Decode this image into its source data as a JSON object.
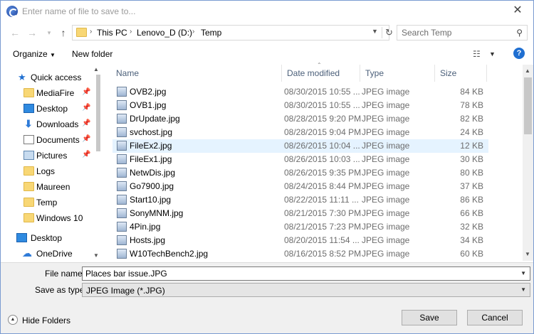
{
  "window": {
    "title": "Enter name of file to save to..."
  },
  "address": {
    "crumbs": [
      "This PC",
      "Lenovo_D (D:)",
      "Temp"
    ]
  },
  "search": {
    "placeholder": "Search Temp"
  },
  "toolbar": {
    "organize_label": "Organize",
    "new_folder_label": "New folder"
  },
  "nav": {
    "items": [
      {
        "label": "Quick access",
        "icon": "star-icon"
      },
      {
        "label": "MediaFire",
        "icon": "folder-icon",
        "pinned": true
      },
      {
        "label": "Desktop",
        "icon": "desktop-icon",
        "pinned": true
      },
      {
        "label": "Downloads",
        "icon": "download-icon",
        "pinned": true
      },
      {
        "label": "Documents",
        "icon": "document-icon",
        "pinned": true
      },
      {
        "label": "Pictures",
        "icon": "pictures-icon",
        "pinned": true
      },
      {
        "label": "Logs",
        "icon": "folder-icon"
      },
      {
        "label": "Maureen",
        "icon": "folder-icon"
      },
      {
        "label": "Temp",
        "icon": "folder-icon"
      },
      {
        "label": "Windows 10",
        "icon": "folder-icon"
      },
      {
        "label": "Desktop",
        "icon": "desktop-icon"
      },
      {
        "label": "OneDrive",
        "icon": "onedrive-icon"
      }
    ]
  },
  "columns": {
    "name": "Name",
    "date": "Date modified",
    "type": "Type",
    "size": "Size"
  },
  "files": [
    {
      "name": "OVB2.jpg",
      "date": "08/30/2015 10:55 ...",
      "type": "JPEG image",
      "size": "84 KB"
    },
    {
      "name": "OVB1.jpg",
      "date": "08/30/2015 10:55 ...",
      "type": "JPEG image",
      "size": "78 KB"
    },
    {
      "name": "DrUpdate.jpg",
      "date": "08/28/2015 9:20 PM",
      "type": "JPEG image",
      "size": "82 KB"
    },
    {
      "name": "svchost.jpg",
      "date": "08/28/2015 9:04 PM",
      "type": "JPEG image",
      "size": "24 KB"
    },
    {
      "name": "FileEx2.jpg",
      "date": "08/26/2015 10:04 ...",
      "type": "JPEG image",
      "size": "12 KB",
      "selected": true
    },
    {
      "name": "FileEx1.jpg",
      "date": "08/26/2015 10:03 ...",
      "type": "JPEG image",
      "size": "30 KB"
    },
    {
      "name": "NetwDis.jpg",
      "date": "08/26/2015 9:35 PM",
      "type": "JPEG image",
      "size": "80 KB"
    },
    {
      "name": "Go7900.jpg",
      "date": "08/24/2015 8:44 PM",
      "type": "JPEG image",
      "size": "37 KB"
    },
    {
      "name": "Start10.jpg",
      "date": "08/22/2015 11:11 ...",
      "type": "JPEG image",
      "size": "86 KB"
    },
    {
      "name": "SonyMNM.jpg",
      "date": "08/21/2015 7:30 PM",
      "type": "JPEG image",
      "size": "66 KB"
    },
    {
      "name": "4Pin.jpg",
      "date": "08/21/2015 7:23 PM",
      "type": "JPEG image",
      "size": "32 KB"
    },
    {
      "name": "Hosts.jpg",
      "date": "08/20/2015 11:54 ...",
      "type": "JPEG image",
      "size": "34 KB"
    },
    {
      "name": "W10TechBench2.jpg",
      "date": "08/16/2015 8:52 PM",
      "type": "JPEG image",
      "size": "60 KB"
    }
  ],
  "form": {
    "file_name_label": "File name:",
    "file_name_value": "Places bar issue.JPG",
    "save_type_label": "Save as type:",
    "save_type_value": "JPEG Image (*.JPG)"
  },
  "footer": {
    "hide_folders_label": "Hide Folders",
    "save_label": "Save",
    "cancel_label": "Cancel"
  }
}
